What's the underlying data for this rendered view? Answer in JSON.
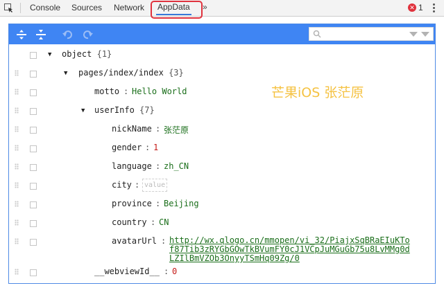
{
  "tabs": {
    "console": "Console",
    "sources": "Sources",
    "network": "Network",
    "appdata": "AppData",
    "more": "»"
  },
  "status": {
    "error_count": "1"
  },
  "search": {
    "placeholder": ""
  },
  "watermark": "芒果iOS 张茫原",
  "tree": {
    "root_key": "object",
    "root_count": "{1}",
    "page_key": "pages/index/index",
    "page_count": "{3}",
    "motto_key": "motto",
    "motto_value": "Hello World",
    "userinfo_key": "userInfo",
    "userinfo_count": "{7}",
    "nickname_key": "nickName",
    "nickname_value": "张茫原",
    "gender_key": "gender",
    "gender_value": "1",
    "language_key": "language",
    "language_value": "zh_CN",
    "city_key": "city",
    "city_placeholder": "value",
    "province_key": "province",
    "province_value": "Beijing",
    "country_key": "country",
    "country_value": "CN",
    "avatar_key": "avatarUrl",
    "avatar_value": "http://wx.qlogo.cn/mmopen/vi_32/PiajxSqBRaEIuKTof87Tib3zRYGbGOwTkBVumFY0cJ1VCpJuMGuGb75u8LvMMg0dLZIlBmVZOb3OnyyTSmHq09Zg/0",
    "webview_key": "__webviewId__",
    "webview_value": "0"
  },
  "colors": {
    "toolbar": "#3f85f3",
    "highlight_box": "#e0323d",
    "string_value": "#1a6e1a",
    "number_value": "#c41a16",
    "watermark": "#f5c242"
  }
}
